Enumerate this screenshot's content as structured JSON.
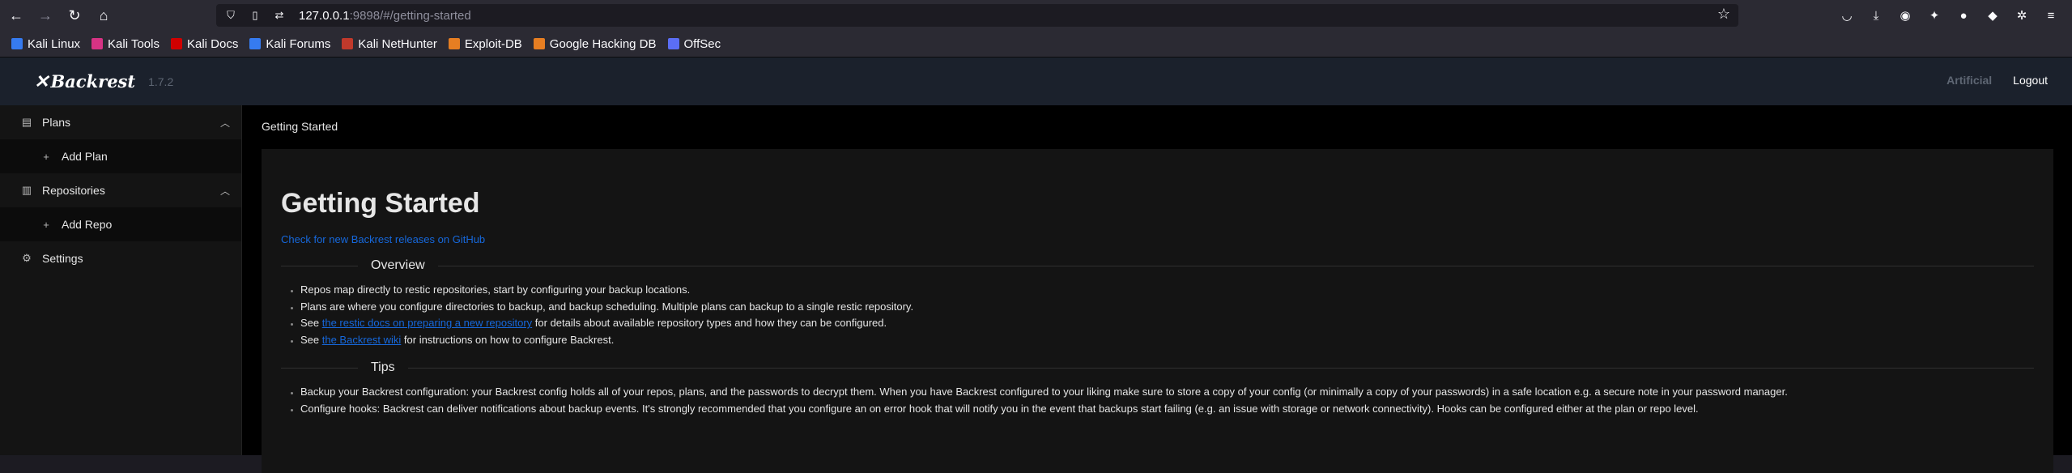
{
  "browser": {
    "url_host": "127.0.0.1",
    "url_rest": ":9898/#/getting-started",
    "bookmarks": [
      {
        "label": "Kali Linux",
        "color": "#367bf0"
      },
      {
        "label": "Kali Tools",
        "color": "#d63384"
      },
      {
        "label": "Kali Docs",
        "color": "#d00000"
      },
      {
        "label": "Kali Forums",
        "color": "#367bf0"
      },
      {
        "label": "Kali NetHunter",
        "color": "#c0392b"
      },
      {
        "label": "Exploit-DB",
        "color": "#e67e22"
      },
      {
        "label": "Google Hacking DB",
        "color": "#e67e22"
      },
      {
        "label": "OffSec",
        "color": "#5b6ef5"
      }
    ]
  },
  "header": {
    "logo": "Backrest",
    "version": "1.7.2",
    "user": "Artificial",
    "logout": "Logout"
  },
  "sidebar": {
    "plans": "Plans",
    "add_plan": "Add Plan",
    "repositories": "Repositories",
    "add_repo": "Add Repo",
    "settings": "Settings"
  },
  "main": {
    "breadcrumb": "Getting Started",
    "title": "Getting Started",
    "github_link": "Check for new Backrest releases on GitHub",
    "overview_heading": "Overview",
    "overview": {
      "item1": "Repos map directly to restic repositories, start by configuring your backup locations.",
      "item2": "Plans are where you configure directories to backup, and backup scheduling. Multiple plans can backup to a single restic repository.",
      "item3_pre": "See ",
      "item3_link": "the restic docs on preparing a new repository",
      "item3_post": " for details about available repository types and how they can be configured.",
      "item4_pre": "See ",
      "item4_link": "the Backrest wiki",
      "item4_post": " for instructions on how to configure Backrest."
    },
    "tips_heading": "Tips",
    "tips": {
      "item1": "Backup your Backrest configuration: your Backrest config holds all of your repos, plans, and the passwords to decrypt them. When you have Backrest configured to your liking make sure to store a copy of your config (or minimally a copy of your passwords) in a safe location e.g. a secure note in your password manager.",
      "item2": "Configure hooks: Backrest can deliver notifications about backup events. It's strongly recommended that you configure an on error hook that will notify you in the event that backups start failing (e.g. an issue with storage or network connectivity). Hooks can be configured either at the plan or repo level."
    }
  }
}
